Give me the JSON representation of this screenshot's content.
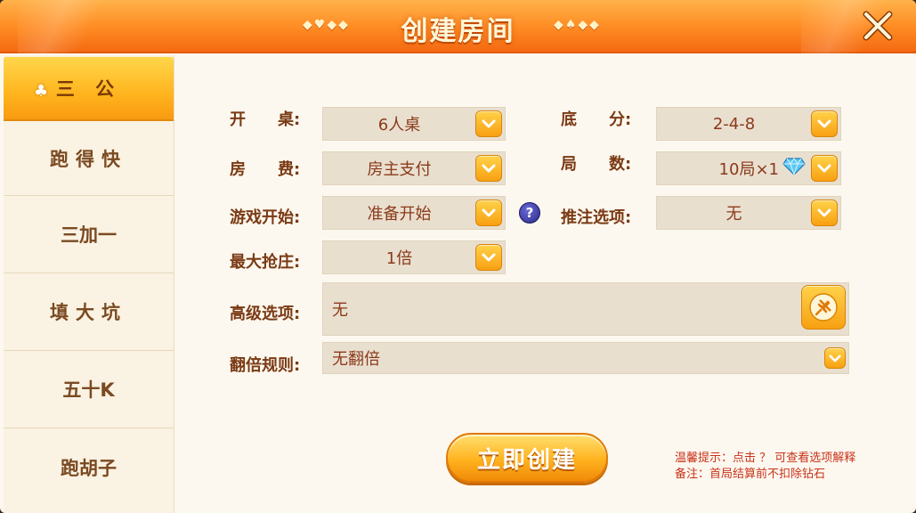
{
  "header": {
    "title": "创建房间",
    "deco_left": "◆♥◆◆",
    "deco_right": "◆♠◆◆"
  },
  "sidebar": {
    "items": [
      {
        "label": "三 公",
        "active": true
      },
      {
        "label": "跑得快",
        "active": false
      },
      {
        "label": "三加一",
        "active": false
      },
      {
        "label": "填大坑",
        "active": false
      },
      {
        "label": "五十K",
        "active": false
      },
      {
        "label": "跑胡子",
        "active": false
      }
    ]
  },
  "form": {
    "table": {
      "label": "开　　桌:",
      "value": "6人桌"
    },
    "base_score": {
      "label": "底　　分:",
      "value": "2-4-8"
    },
    "room_fee": {
      "label": "房　　费:",
      "value": "房主支付"
    },
    "rounds": {
      "label": "局　　数:",
      "value": "10局×1",
      "icon": "diamond-icon"
    },
    "game_start": {
      "label": "游戏开始:",
      "value": "准备开始"
    },
    "bet_option": {
      "label": "推注选项:",
      "value": "无"
    },
    "max_banker": {
      "label": "最大抢庄:",
      "value": "1倍"
    },
    "advanced": {
      "label": "高级选项:",
      "value": "无"
    },
    "double_rule": {
      "label": "翻倍规则:",
      "value": "无翻倍"
    },
    "help_glyph": "?"
  },
  "create_button": {
    "label": "立即创建"
  },
  "tips": {
    "line1": "温馨提示：点击 ？ 可查看选项解释",
    "line2": "备注：首局结算前不扣除钻石"
  },
  "colors": {
    "header_orange": "#ff8a22",
    "label_brown": "#7a3a14",
    "value_red": "#8a3a1a",
    "tip_red": "#c8321a",
    "button_gold": "#ffb21e"
  }
}
